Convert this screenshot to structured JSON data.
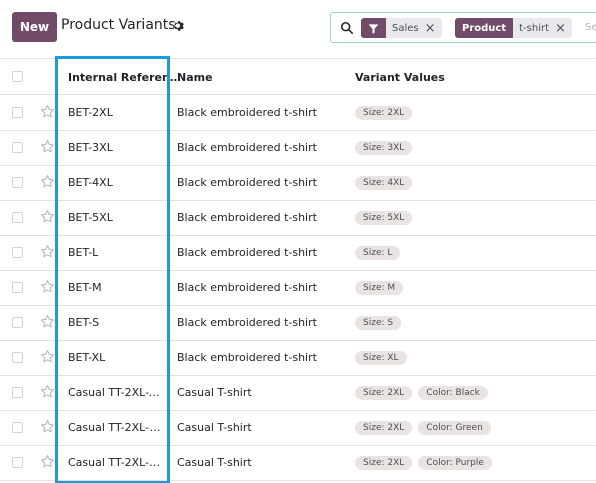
{
  "header": {
    "new_label": "New",
    "title": "Product Variants",
    "settings_icon": "gear-icon"
  },
  "search": {
    "icon": "search-icon",
    "facets": [
      {
        "icon": "filter-icon",
        "label": "",
        "value": "Sales"
      },
      {
        "icon": "",
        "label": "Product",
        "value": "t-shirt"
      }
    ],
    "remove_glyph": "×",
    "placeholder": "Se"
  },
  "table": {
    "columns": [
      "Internal Referen…",
      "Name",
      "Variant Values"
    ],
    "rows": [
      {
        "ref": "BET-2XL",
        "name": "Black embroidered t-shirt",
        "tags": [
          "Size: 2XL"
        ]
      },
      {
        "ref": "BET-3XL",
        "name": "Black embroidered t-shirt",
        "tags": [
          "Size: 3XL"
        ]
      },
      {
        "ref": "BET-4XL",
        "name": "Black embroidered t-shirt",
        "tags": [
          "Size: 4XL"
        ]
      },
      {
        "ref": "BET-5XL",
        "name": "Black embroidered t-shirt",
        "tags": [
          "Size: 5XL"
        ]
      },
      {
        "ref": "BET-L",
        "name": "Black embroidered t-shirt",
        "tags": [
          "Size: L"
        ]
      },
      {
        "ref": "BET-M",
        "name": "Black embroidered t-shirt",
        "tags": [
          "Size: M"
        ]
      },
      {
        "ref": "BET-S",
        "name": "Black embroidered t-shirt",
        "tags": [
          "Size: S"
        ]
      },
      {
        "ref": "BET-XL",
        "name": "Black embroidered t-shirt",
        "tags": [
          "Size: XL"
        ]
      },
      {
        "ref": "Casual TT-2XL-Bl…",
        "name": "Casual T-shirt",
        "tags": [
          "Size: 2XL",
          "Color: Black"
        ]
      },
      {
        "ref": "Casual TT-2XL-G…",
        "name": "Casual T-shirt",
        "tags": [
          "Size: 2XL",
          "Color: Green"
        ]
      },
      {
        "ref": "Casual TT-2XL-P…",
        "name": "Casual T-shirt",
        "tags": [
          "Size: 2XL",
          "Color: Purple"
        ]
      }
    ]
  },
  "colors": {
    "brand": "#714b67",
    "highlight": "#1a9be0",
    "search_border": "#9ad0d6"
  }
}
